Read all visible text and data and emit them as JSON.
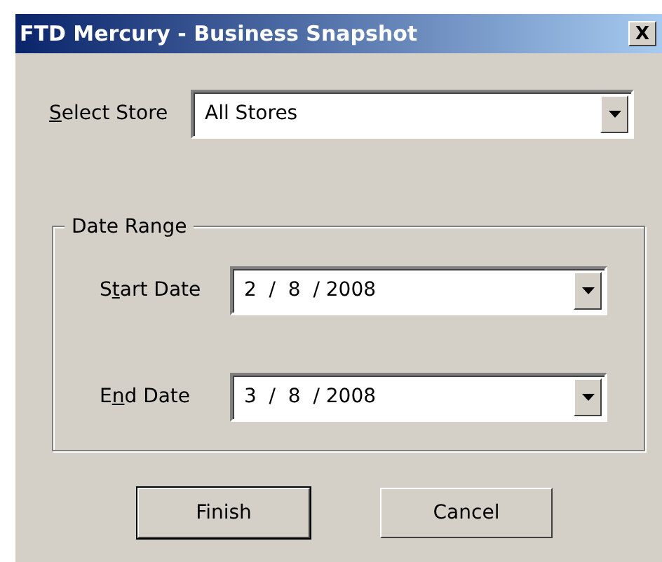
{
  "window": {
    "title": "FTD Mercury - Business Snapshot",
    "close": "X"
  },
  "store": {
    "label": {
      "key": "S",
      "after": "elect Store"
    },
    "value": "All Stores"
  },
  "date_range": {
    "legend": "Date Range",
    "fields": [
      {
        "label": {
          "before": "S",
          "key": "t",
          "after": "art Date"
        },
        "value": "2  /  8  / 2008"
      },
      {
        "label": {
          "before": "E",
          "key": "n",
          "after": "d Date"
        },
        "value": "3  /  8  / 2008"
      }
    ]
  },
  "buttons": [
    {
      "label": "Finish",
      "default": true
    },
    {
      "label": "Cancel",
      "default": false
    }
  ]
}
